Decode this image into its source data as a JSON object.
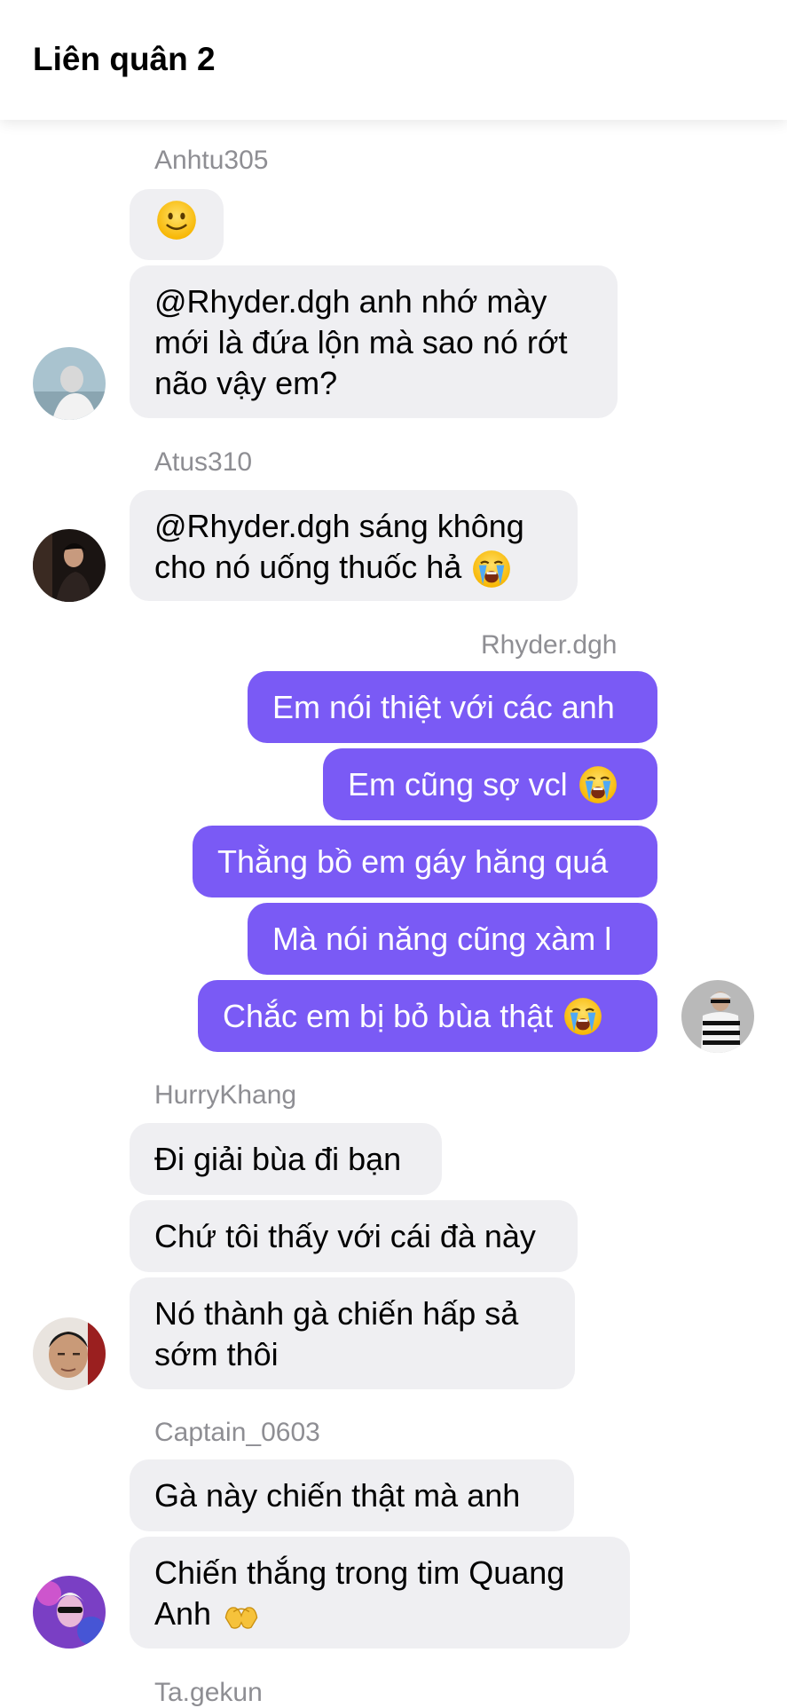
{
  "header": {
    "title": "Liên quân 2"
  },
  "groups": [
    {
      "sender": "Anhtu305",
      "messages": [
        {
          "text": ""
        },
        {
          "text": "@Rhyder.dgh anh nhớ mày mới là đứa lộn mà sao nó rớt não vậy em?"
        }
      ]
    },
    {
      "sender": "Atus310",
      "messages": [
        {
          "text": "@Rhyder.dgh sáng không cho nó uống thuốc hả"
        }
      ]
    },
    {
      "sender": "Rhyder.dgh",
      "messages": [
        {
          "text": "Em nói thiệt với các anh"
        },
        {
          "text": "Em cũng sợ vcl"
        },
        {
          "text": "Thằng bồ em gáy hăng quá"
        },
        {
          "text": "Mà nói năng cũng xàm l"
        },
        {
          "text": "Chắc em bị bỏ bùa thật"
        }
      ]
    },
    {
      "sender": "HurryKhang",
      "messages": [
        {
          "text": "Đi giải bùa đi bạn"
        },
        {
          "text": "Chứ tôi thấy với cái đà này"
        },
        {
          "text": "Nó thành gà chiến hấp sả sớm thôi"
        }
      ]
    },
    {
      "sender": "Captain_0603",
      "messages": [
        {
          "text": "Gà này chiến thật mà anh"
        },
        {
          "text": "Chiến thắng trong tim Quang Anh"
        }
      ]
    },
    {
      "sender": "Ta.gekun",
      "messages": []
    }
  ],
  "icons": {
    "smile": "slightly-smiling-face-icon",
    "cry": "loudly-crying-face-icon",
    "heart_hands": "heart-hands-icon"
  },
  "colors": {
    "outgoing_bubble": "#7a5af5",
    "incoming_bubble": "#efeff2",
    "sender_name": "#8e8e93"
  }
}
